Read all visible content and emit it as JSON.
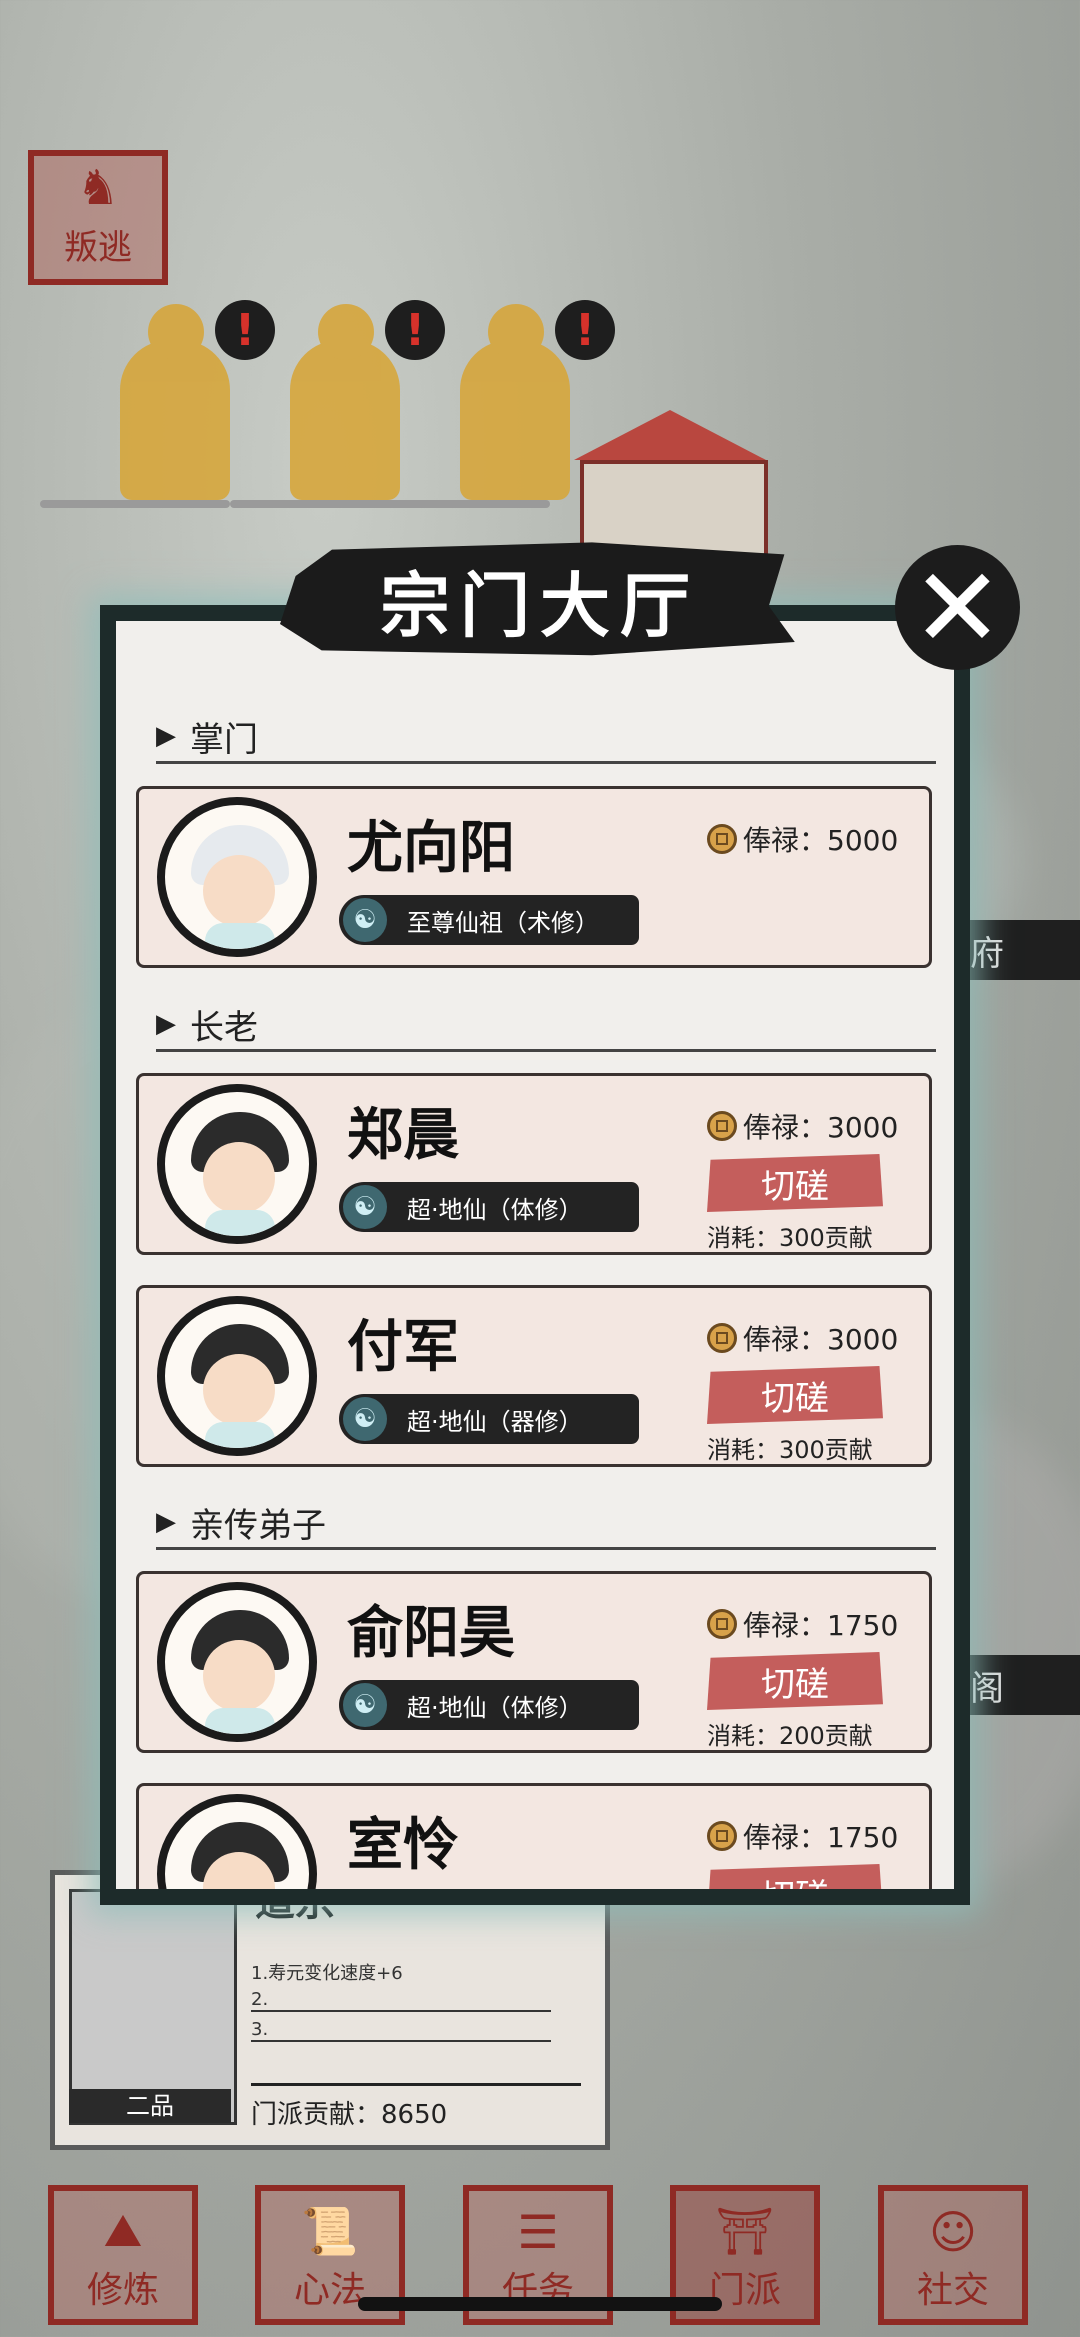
{
  "top_button": {
    "label": "叛逃",
    "icon": "runner-icon"
  },
  "alerts": [
    "!",
    "!",
    "!"
  ],
  "modal": {
    "title": "宗门大厅",
    "close_glyph": "✕",
    "sections": [
      {
        "header": "掌门",
        "members": [
          {
            "name": "尤向阳",
            "realm": "至尊仙祖（术修）",
            "salary_label": "俸禄：5000",
            "avatar": "white"
          }
        ]
      },
      {
        "header": "长老",
        "members": [
          {
            "name": "郑晨",
            "realm": "超·地仙（体修）",
            "salary_label": "俸禄：3000",
            "spar_label": "切磋",
            "cost_label": "消耗：300贡献",
            "avatar": "dark"
          },
          {
            "name": "付军",
            "realm": "超·地仙（器修）",
            "salary_label": "俸禄：3000",
            "spar_label": "切磋",
            "cost_label": "消耗：300贡献",
            "avatar": "dark"
          }
        ]
      },
      {
        "header": "亲传弟子",
        "members": [
          {
            "name": "俞阳昊",
            "realm": "超·地仙（体修）",
            "salary_label": "俸禄：1750",
            "spar_label": "切磋",
            "cost_label": "消耗：200贡献",
            "avatar": "dark"
          },
          {
            "name": "室怜",
            "salary_label": "俸禄：1750",
            "spar_label": "切磋",
            "avatar": "dark"
          }
        ]
      }
    ]
  },
  "sect_panel": {
    "title": "道宗",
    "grade": "二品",
    "lines": [
      "1.寿元变化速度+6",
      "2.",
      "3."
    ],
    "contribution_label": "门派贡献：8650"
  },
  "side_labels": {
    "right_1": "府",
    "right_2": "阁"
  },
  "nav": [
    {
      "label": "修炼",
      "icon": "mountain-icon"
    },
    {
      "label": "心法",
      "icon": "scroll-icon"
    },
    {
      "label": "任务",
      "icon": "book-icon"
    },
    {
      "label": "门派",
      "icon": "gate-icon"
    },
    {
      "label": "社交",
      "icon": "people-icon"
    }
  ]
}
